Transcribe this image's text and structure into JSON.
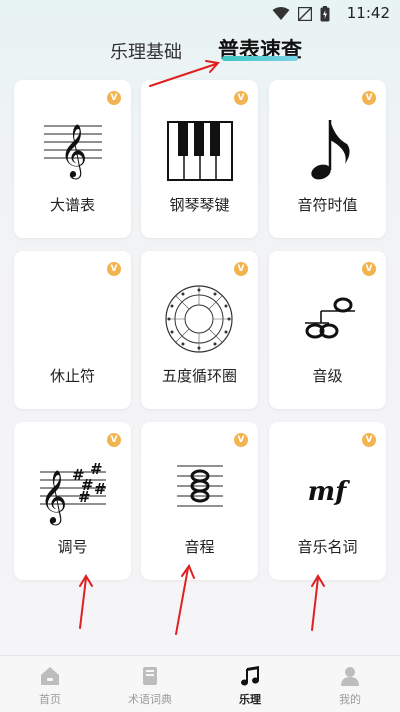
{
  "status_bar": {
    "time": "11:42"
  },
  "tabs": [
    {
      "label": "乐理基础"
    },
    {
      "label": "普表速查"
    }
  ],
  "cards": [
    {
      "label": "大谱表",
      "vip": "V"
    },
    {
      "label": "钢琴琴键",
      "vip": "V"
    },
    {
      "label": "音符时值",
      "vip": "V"
    },
    {
      "label": "休止符",
      "vip": "V"
    },
    {
      "label": "五度循环圈",
      "vip": "V"
    },
    {
      "label": "音级",
      "vip": "V"
    },
    {
      "label": "调号",
      "vip": "V"
    },
    {
      "label": "音程",
      "vip": "V"
    },
    {
      "label": "音乐名词",
      "vip": "V"
    }
  ],
  "card_art_text": {
    "dynamic_mark": "mf"
  },
  "bottom_nav": [
    {
      "label": "首页",
      "icon": "home-icon"
    },
    {
      "label": "术语词典",
      "icon": "dictionary-icon"
    },
    {
      "label": "乐理",
      "icon": "music-note-icon"
    },
    {
      "label": "我的",
      "icon": "profile-icon"
    }
  ],
  "colors": {
    "accent_gradient_start": "#3cc7c0",
    "accent_gradient_end": "#7bd3ea",
    "vip_badge": "#f2b450",
    "annotation_arrow": "#e02020"
  }
}
